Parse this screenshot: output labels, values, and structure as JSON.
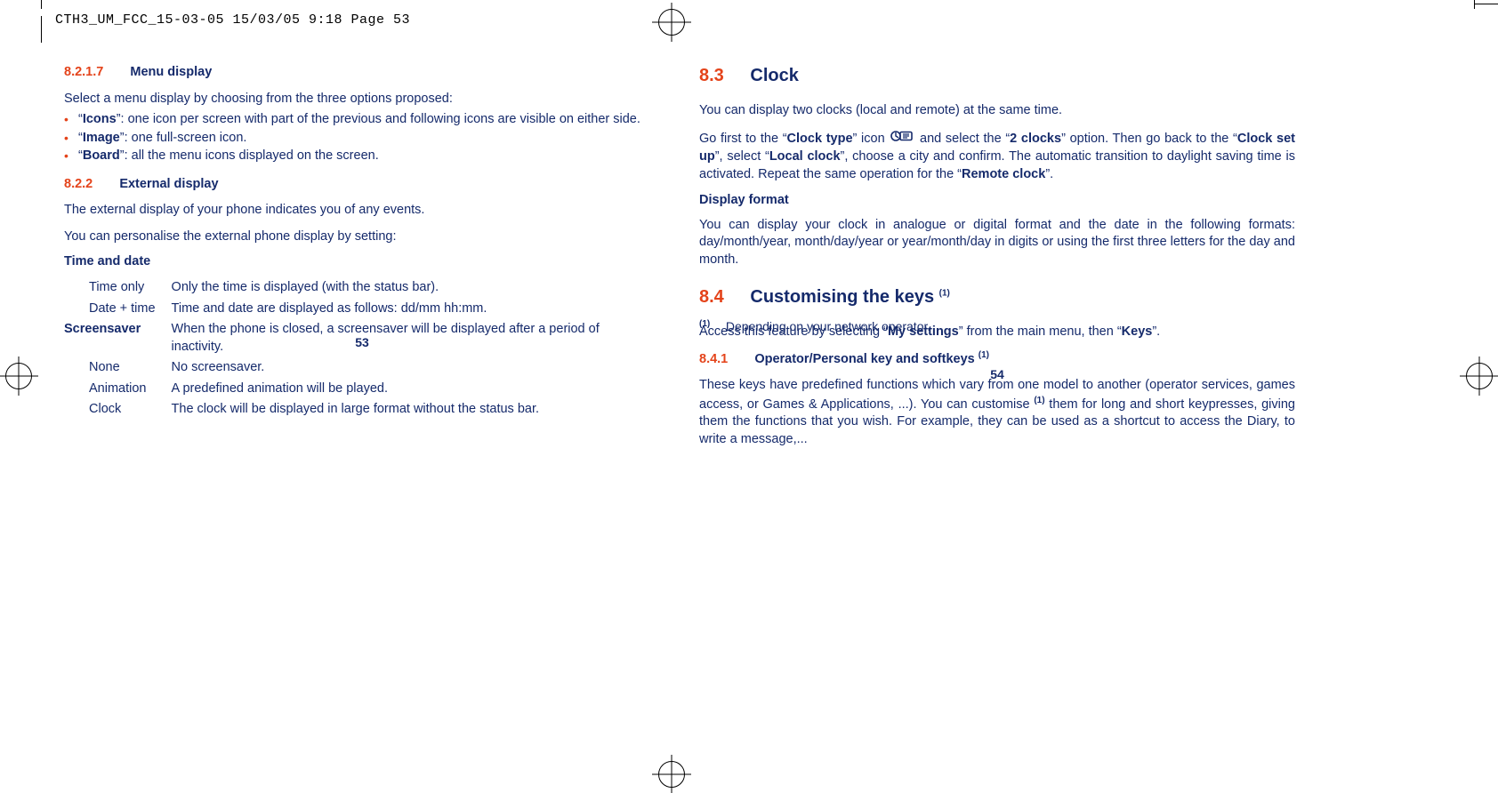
{
  "header": {
    "slug": "CTH3_UM_FCC_15-03-05  15/03/05  9:18  Page 53"
  },
  "left": {
    "s8217": {
      "num": "8.2.1.7",
      "title": "Menu display"
    },
    "intro8217": "Select a menu display by choosing from the three options proposed:",
    "bullets": [
      {
        "b": "Icons",
        "rest": "”: one icon per screen with part of the previous and following icons are visible on either side."
      },
      {
        "b": "Image",
        "rest": "”: one full-screen icon."
      },
      {
        "b": "Board",
        "rest": "”: all the menu icons displayed on the screen."
      }
    ],
    "s822": {
      "num": "8.2.2",
      "title": "External display"
    },
    "p822a": "The external display of your phone indicates you of any events.",
    "p822b": "You can personalise the external phone display by setting:",
    "timeDateLabel": "Time and date",
    "rows1": [
      {
        "k": "Time only",
        "v": "Only the time is displayed (with the status bar)."
      },
      {
        "k": "Date + time",
        "v": "Time and date are displayed as follows: dd/mm hh:mm."
      }
    ],
    "screensaver": {
      "k": "Screensaver",
      "v": "When the phone is closed, a screensaver will be displayed after a period of inactivity."
    },
    "rows2": [
      {
        "k": "None",
        "v": "No screensaver."
      },
      {
        "k": "Animation",
        "v": "A predefined animation will be played."
      },
      {
        "k": "Clock",
        "v": "The clock will be displayed in large format without the status bar."
      }
    ],
    "pageNum": "53"
  },
  "right": {
    "s83": {
      "num": "8.3",
      "title": "Clock"
    },
    "p83a": "You can display two clocks (local and remote) at the same time.",
    "p83b": {
      "t1": "Go first to the “",
      "b1": "Clock type",
      "t2": "” icon ",
      "t3": " and select the “",
      "b2": "2 clocks",
      "t4": "” option. Then go back to the “",
      "b3": "Clock set up",
      "t5": "”, select “",
      "b4": "Local clock",
      "t6": "”, choose a city and confirm. The automatic transition to daylight saving time is activated. Repeat the same operation for the “",
      "b5": "Remote clock",
      "t7": "”."
    },
    "dispFmtLabel": "Display format",
    "dispFmtText": "You can display your clock in analogue or digital format and the date in the following formats: day/month/year, month/day/year or year/month/day in digits or using the first three letters for the day and month.",
    "s84": {
      "num": "8.4",
      "title_a": "Customising the keys ",
      "sup": "(1)"
    },
    "p84a": {
      "t1": "Access this feature by selecting “",
      "b1": "My settings",
      "t2": "” from the main menu, then “",
      "b2": "Keys",
      "t3": "”."
    },
    "s841": {
      "num": "8.4.1",
      "title_a": "Operator/Personal key and softkeys ",
      "sup": "(1)"
    },
    "p841": {
      "t1": "These keys have predefined functions which vary from one model to another (operator services, games access, or Games & Applications, ...). You can customise ",
      "sup": "(1)",
      "t2": " them for long and short keypresses, giving them the functions that you wish. For example, they can be used as a shortcut to access the Diary, to write a message,..."
    },
    "footnote": {
      "mark": "(1)",
      "text": "Depending on your network operator."
    },
    "pageNum": "54"
  }
}
